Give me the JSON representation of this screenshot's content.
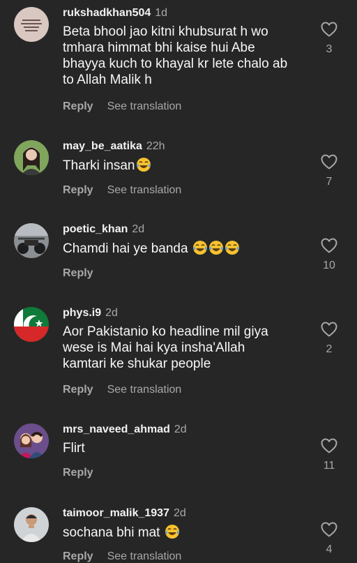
{
  "comments": [
    {
      "username": "rukshadkhan504",
      "time": "1d",
      "text": "Beta bhool jao kitni khubsurat h wo\ntmhara himmat bhi kaise hui Abe\nbhayya kuch to khayal kr lete chalo ab\nto Allah Malik h",
      "emoji_count": 0,
      "reply_label": "Reply",
      "translate_label": "See translation",
      "likes": "3",
      "avatar": "avatar-rukshadkhan"
    },
    {
      "username": "may_be_aatika",
      "time": "22h",
      "text": "Tharki insan",
      "emoji_count": 1,
      "reply_label": "Reply",
      "translate_label": "See translation",
      "likes": "7",
      "avatar": "avatar-may-be-aatika"
    },
    {
      "username": "poetic_khan",
      "time": "2d",
      "text": "Chamdi hai ye banda ",
      "emoji_count": 3,
      "reply_label": "Reply",
      "translate_label": "",
      "likes": "10",
      "avatar": "avatar-poetic-khan"
    },
    {
      "username": "phys.i9",
      "time": "2d",
      "text": "Aor Pakistanio ko headline mil giya\nwese is Mai hai kya insha'Allah\nkamtari ke shukar people",
      "emoji_count": 0,
      "reply_label": "Reply",
      "translate_label": "See translation",
      "likes": "2",
      "avatar": "avatar-phys-i9"
    },
    {
      "username": "mrs_naveed_ahmad",
      "time": "2d",
      "text": "Flirt",
      "emoji_count": 0,
      "reply_label": "Reply",
      "translate_label": "",
      "likes": "11",
      "avatar": "avatar-mrs-naveed-ahmad"
    },
    {
      "username": "taimoor_malik_1937",
      "time": "2d",
      "text": "sochana bhi mat ",
      "emoji_count": 1,
      "reply_label": "Reply",
      "translate_label": "See translation",
      "likes": "4",
      "avatar": "avatar-taimoor-malik"
    }
  ],
  "icons": {
    "like": "heart-outline-icon",
    "emoji": "tears-of-joy-emoji"
  },
  "colors": {
    "background": "#262626",
    "primary_text": "#f5f5f5",
    "secondary_text": "#a8a8a8"
  }
}
